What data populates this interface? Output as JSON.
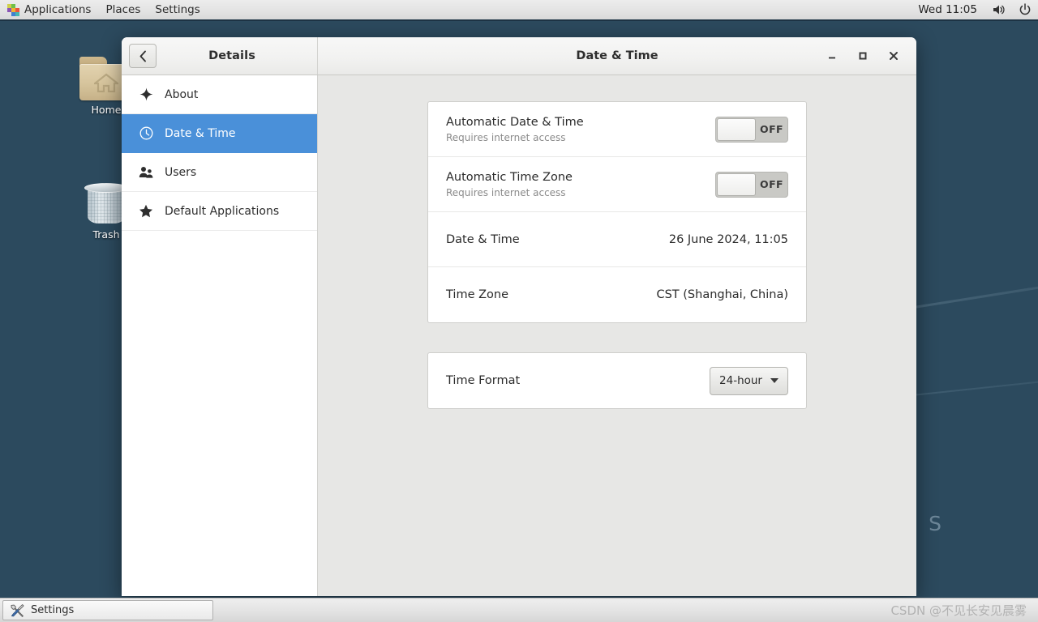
{
  "panel": {
    "apps_label": "Applications",
    "places_label": "Places",
    "settings_label": "Settings",
    "clock": "Wed 11:05",
    "volume_icon": "speaker-icon",
    "power_icon": "power-icon",
    "apps_icon": "applications-mosaic-icon"
  },
  "desktop": {
    "icons": [
      {
        "name": "home-folder",
        "label": "Home"
      },
      {
        "name": "trash",
        "label": "Trash"
      }
    ],
    "wallpaper_text": "O S"
  },
  "window": {
    "back_icon": "chevron-left-icon",
    "sidebar_title": "Details",
    "title": "Date & Time",
    "controls": {
      "minimize": "—",
      "maximize": "□",
      "close": "✕"
    }
  },
  "sidebar": {
    "items": [
      {
        "label": "About",
        "icon": "sparkle-icon",
        "selected": false
      },
      {
        "label": "Date & Time",
        "icon": "clock-icon",
        "selected": true
      },
      {
        "label": "Users",
        "icon": "people-icon",
        "selected": false
      },
      {
        "label": "Default Applications",
        "icon": "star-icon",
        "selected": false
      }
    ]
  },
  "main": {
    "card1": {
      "auto_datetime": {
        "title": "Automatic Date & Time",
        "subtitle": "Requires internet access",
        "state": "OFF"
      },
      "auto_timezone": {
        "title": "Automatic Time Zone",
        "subtitle": "Requires internet access",
        "state": "OFF"
      },
      "datetime": {
        "title": "Date & Time",
        "value": "26 June 2024, 11:05"
      },
      "timezone": {
        "title": "Time Zone",
        "value": "CST (Shanghai, China)"
      }
    },
    "card2": {
      "time_format": {
        "title": "Time Format",
        "value": "24-hour"
      }
    }
  },
  "taskbar": {
    "task_label": "Settings",
    "task_icon": "tools-icon",
    "watermark": "CSDN @不见长安见晨雾"
  },
  "colors": {
    "accent": "#4a90d9",
    "panel_bg": "#e8e8e8",
    "content_bg": "#e7e7e5",
    "card_bg": "#ffffff",
    "desktop_top": "#456a83",
    "desktop_bottom": "#24435c"
  }
}
